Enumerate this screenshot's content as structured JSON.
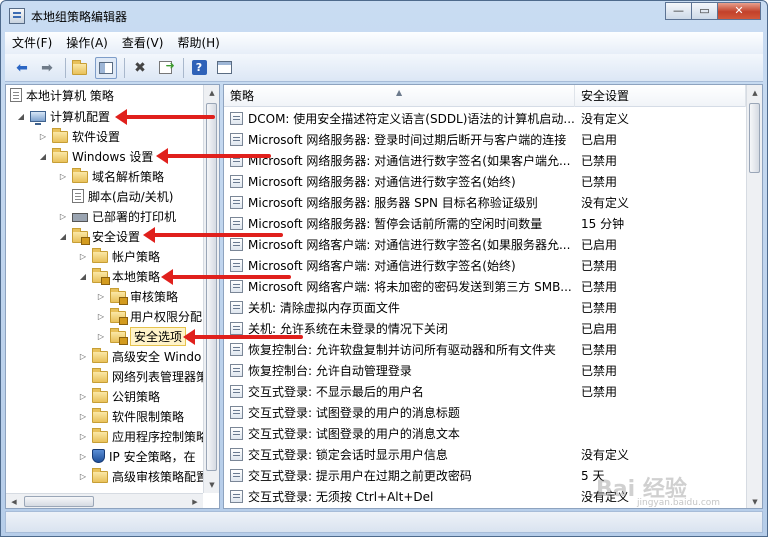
{
  "window": {
    "title": "本地组策略编辑器",
    "minimize": "—",
    "maximize": "▭",
    "close": "✕"
  },
  "menu": [
    "文件(F)",
    "操作(A)",
    "查看(V)",
    "帮助(H)"
  ],
  "toolbar_icons": [
    "back-arrow-icon",
    "forward-arrow-icon",
    "up-folder-icon",
    "show-tree-icon",
    "delete-icon",
    "export-icon",
    "help-icon",
    "properties-icon"
  ],
  "tree": {
    "root": "本地计算机 策略",
    "computer_config": "计算机配置",
    "software_settings": "软件设置",
    "windows_settings": "Windows 设置",
    "name_resolution": "域名解析策略",
    "scripts": "脚本(启动/关机)",
    "printers": "已部署的打印机",
    "security_settings": "安全设置",
    "account_policies": "帐户策略",
    "local_policies": "本地策略",
    "audit_policy": "审核策略",
    "user_rights": "用户权限分配",
    "security_options": "安全选项",
    "advanced_firewall": "高级安全 Windo",
    "network_list": "网络列表管理器策",
    "public_key": "公钥策略",
    "software_restriction": "软件限制策略",
    "app_control": "应用程序控制策略",
    "ip_security": "IP 安全策略，在",
    "advanced_audit": "高级审核策略配置"
  },
  "list": {
    "col_policy": "策略",
    "col_setting": "安全设置",
    "rows": [
      {
        "policy": "DCOM: 使用安全描述符定义语言(SDDL)语法的计算机启动...",
        "setting": "没有定义"
      },
      {
        "policy": "Microsoft 网络服务器: 登录时间过期后断开与客户端的连接",
        "setting": "已启用"
      },
      {
        "policy": "Microsoft 网络服务器: 对通信进行数字签名(如果客户端允...",
        "setting": "已禁用"
      },
      {
        "policy": "Microsoft 网络服务器: 对通信进行数字签名(始终)",
        "setting": "已禁用"
      },
      {
        "policy": "Microsoft 网络服务器: 服务器 SPN 目标名称验证级别",
        "setting": "没有定义"
      },
      {
        "policy": "Microsoft 网络服务器: 暂停会话前所需的空闲时间数量",
        "setting": "15 分钟"
      },
      {
        "policy": "Microsoft 网络客户端: 对通信进行数字签名(如果服务器允...",
        "setting": "已启用"
      },
      {
        "policy": "Microsoft 网络客户端: 对通信进行数字签名(始终)",
        "setting": "已禁用"
      },
      {
        "policy": "Microsoft 网络客户端: 将未加密的密码发送到第三方 SMB...",
        "setting": "已禁用"
      },
      {
        "policy": "关机: 清除虚拟内存页面文件",
        "setting": "已禁用"
      },
      {
        "policy": "关机: 允许系统在未登录的情况下关闭",
        "setting": "已启用"
      },
      {
        "policy": "恢复控制台: 允许软盘复制并访问所有驱动器和所有文件夹",
        "setting": "已禁用"
      },
      {
        "policy": "恢复控制台: 允许自动管理登录",
        "setting": "已禁用"
      },
      {
        "policy": "交互式登录: 不显示最后的用户名",
        "setting": "已禁用"
      },
      {
        "policy": "交互式登录: 试图登录的用户的消息标题",
        "setting": ""
      },
      {
        "policy": "交互式登录: 试图登录的用户的消息文本",
        "setting": ""
      },
      {
        "policy": "交互式登录: 锁定会话时显示用户信息",
        "setting": "没有定义"
      },
      {
        "policy": "交互式登录: 提示用户在过期之前更改密码",
        "setting": "5 天"
      },
      {
        "policy": "交互式登录: 无须按 Ctrl+Alt+Del",
        "setting": "没有定义"
      }
    ]
  },
  "watermark": {
    "text": "Bai 经验",
    "sub": "jingyan.baidu.com"
  },
  "colors": {
    "annotation_arrow": "#e0201c",
    "selection": "#fff3c9"
  }
}
